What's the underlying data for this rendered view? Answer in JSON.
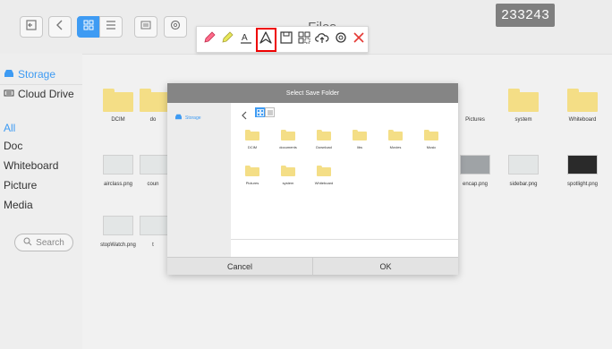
{
  "header": {
    "title": "Files",
    "counter": "233243"
  },
  "toolbar": {
    "tools": [
      "pen-icon",
      "highlighter-icon",
      "text-icon",
      "select-icon",
      "save-icon",
      "qr-code-icon",
      "cloud-upload-icon",
      "gear-icon",
      "close-icon"
    ],
    "highlight_color": "#e00000",
    "accent": "#3e9bf3"
  },
  "sidebar": {
    "storage": "Storage",
    "cloud": "Cloud Drive",
    "categories": [
      "All",
      "Doc",
      "Whiteboard",
      "Picture",
      "Media"
    ],
    "search": "Search"
  },
  "files": {
    "row1": [
      "DCIM",
      "do",
      "Pictures",
      "system",
      "Whiteboard"
    ],
    "row2": [
      "airclass.png",
      "coun",
      "encap.png",
      "sidebar.png",
      "spotlight.png"
    ],
    "row3": [
      "stopWatch.png",
      "t"
    ]
  },
  "modal": {
    "title": "Select Save Folder",
    "storage": "Storage",
    "folders": [
      "DCIM",
      "documents",
      "Download",
      "libs",
      "Movies",
      "Music",
      "Pictures",
      "system",
      "Whiteboard"
    ],
    "cancel": "Cancel",
    "ok": "OK"
  }
}
